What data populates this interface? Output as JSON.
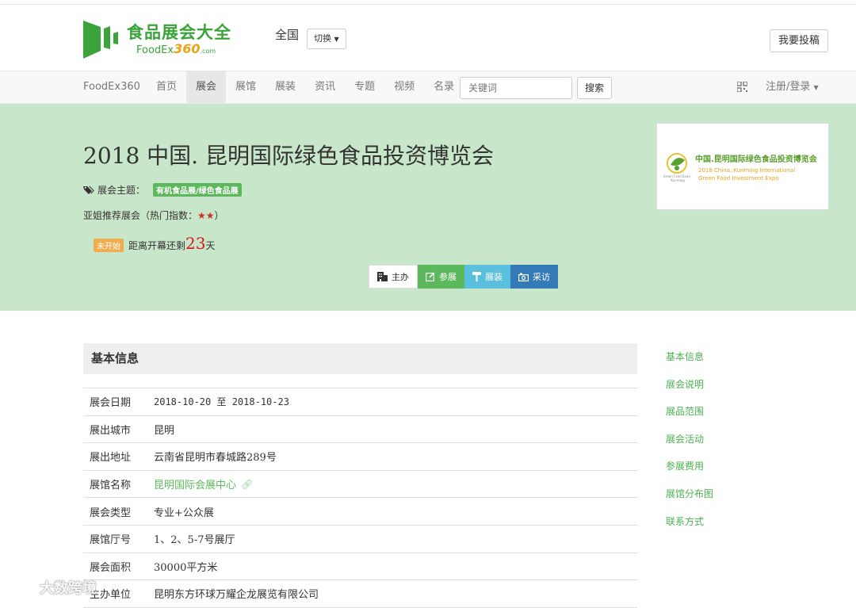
{
  "brand": {
    "name_cn": "食品展会大全",
    "name_en_prefix": "FoodEx",
    "name_en_num": "360",
    "name_en_suffix": ".com",
    "color": "#3aa33a"
  },
  "header": {
    "region": "全国",
    "switch_label": "切换",
    "contribute_label": "我要投稿"
  },
  "nav": {
    "brand": "FoodEx360",
    "items": [
      {
        "label": "首页",
        "active": false
      },
      {
        "label": "展会",
        "active": true
      },
      {
        "label": "展馆",
        "active": false
      },
      {
        "label": "展装",
        "active": false
      },
      {
        "label": "资讯",
        "active": false
      },
      {
        "label": "专题",
        "active": false
      },
      {
        "label": "视频",
        "active": false
      },
      {
        "label": "名录",
        "active": false
      }
    ],
    "search_placeholder": "关键词",
    "search_button": "搜索",
    "login_label": "注册/登录"
  },
  "expo": {
    "title": "2018 中国. 昆明国际绿色食品投资博览会",
    "theme_label": "展会主题：",
    "theme_tag": "有机食品展/绿色食品展",
    "recommend_text": "亚姐推荐展会（热门指数：",
    "stars": "★★",
    "recommend_close": "）",
    "status": "未开始",
    "countdown_prefix": "距离开幕还剩",
    "countdown_days": "23",
    "countdown_suffix": "天",
    "actions": {
      "host": "主办",
      "join": "参展",
      "build": "展装",
      "visit": "采访"
    },
    "poster": {
      "title_cn": "中国.昆明国际绿色食品投资博览会",
      "title_en_1": "2018 China. Kunming International",
      "title_en_2": "Green Food Investment Expo",
      "logo_text": "Green Food Expo · Kunming"
    }
  },
  "info": {
    "heading": "基本信息",
    "rows": [
      {
        "label": "展会日期",
        "value": "2018-10-20 至 2018-10-23"
      },
      {
        "label": "展出城市",
        "value": "昆明"
      },
      {
        "label": "展出地址",
        "value": "云南省昆明市春城路289号"
      },
      {
        "label": "展馆名称",
        "value": "昆明国际会展中心"
      },
      {
        "label": "展会类型",
        "value": "专业+公众展"
      },
      {
        "label": "展馆厅号",
        "value": "1、2、5-7号展厅"
      },
      {
        "label": "展会面积",
        "value": "30000平方米"
      },
      {
        "label": "主办单位",
        "value": "昆明东方环球万耀企龙展览有限公司"
      }
    ]
  },
  "sidenav": [
    "基本信息",
    "展会说明",
    "展品范围",
    "展会活动",
    "参展费用",
    "展馆分布图",
    "联系方式"
  ],
  "watermark": "大数跨境",
  "colors": {
    "hero_bg": "#c8e6c9",
    "green": "#5cb85c",
    "info": "#5bc0de",
    "primary": "#337ab7",
    "warning": "#f0ad4e",
    "countdown": "#d9161c"
  }
}
